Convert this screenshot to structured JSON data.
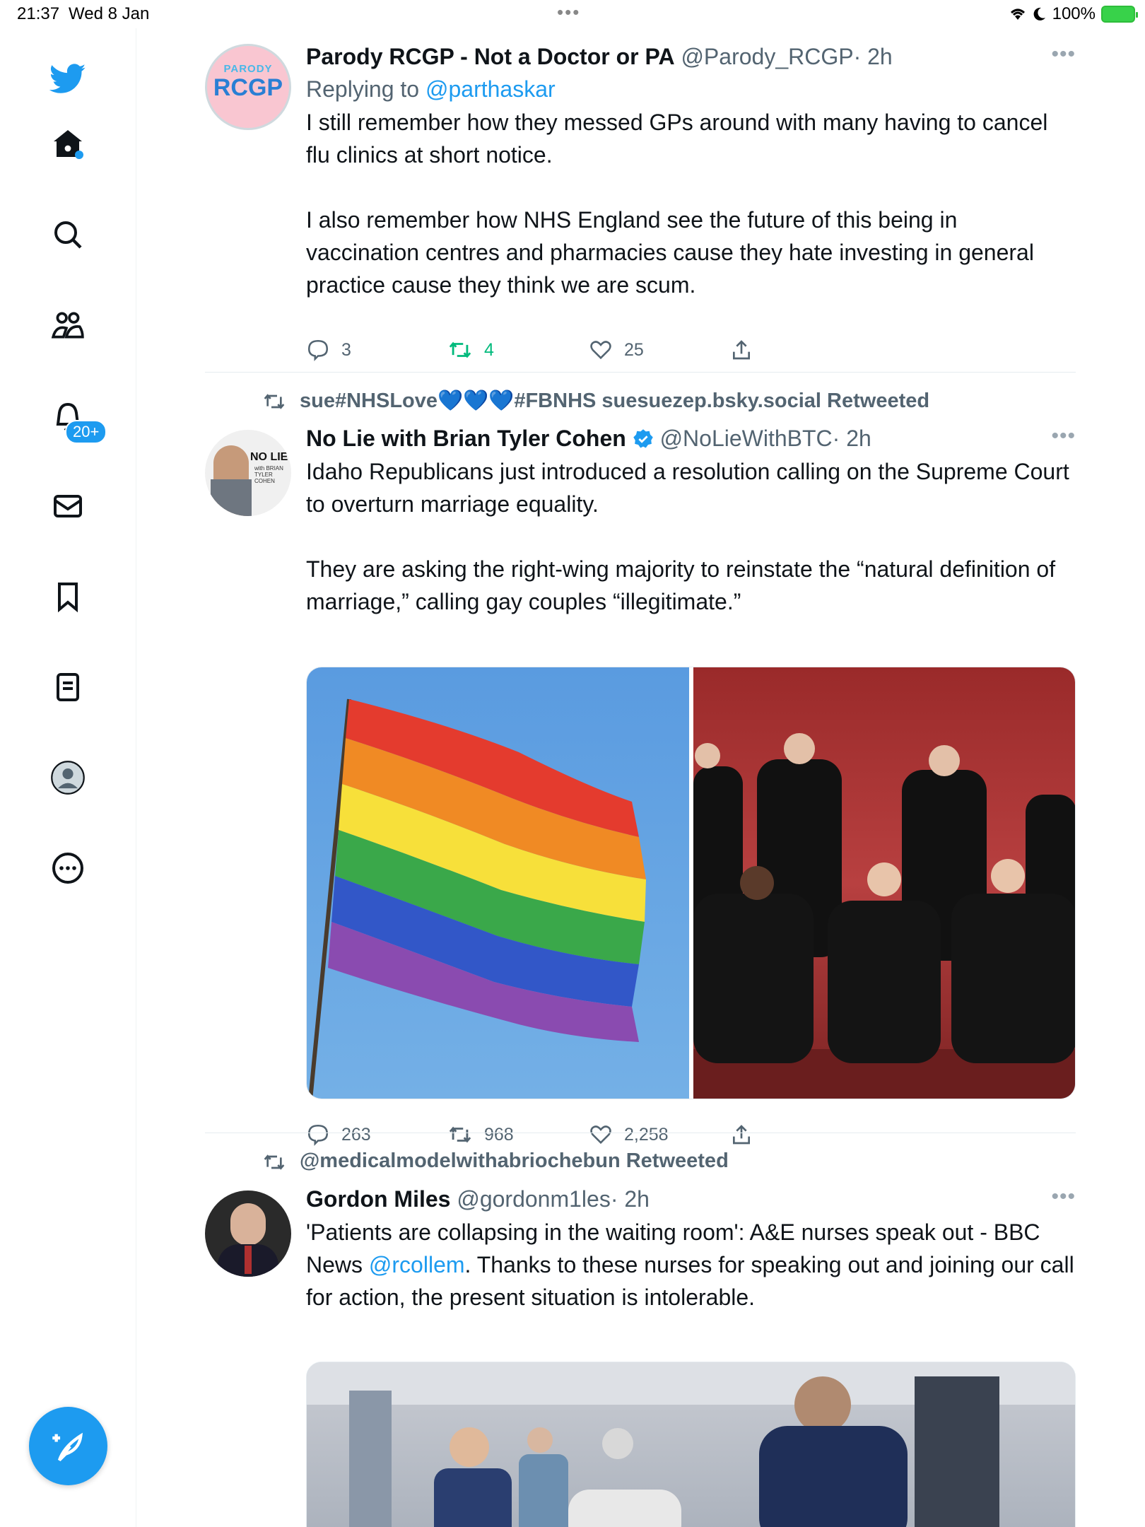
{
  "status_bar": {
    "time": "21:37",
    "date": "Wed 8 Jan",
    "battery": "100%"
  },
  "sidebar": {
    "notifications_badge": "20+",
    "items": [
      "home-icon",
      "search-icon",
      "communities-icon",
      "notifications-icon",
      "messages-icon",
      "bookmarks-icon",
      "lists-icon",
      "profile-icon",
      "more-icon"
    ]
  },
  "tweets": [
    {
      "avatar_text_top": "PARODY",
      "avatar_text_main": "RCGP",
      "name": "Parody RCGP - Not a Doctor or PA",
      "handle": "@Parody_RCGP",
      "time": "· 2h",
      "reply_prefix": "Replying to ",
      "reply_to": "@parthaskar",
      "paragraph1": "I still remember how they messed GPs around with many having to cancel flu clinics at short notice.",
      "paragraph2": "I also remember how NHS England see the future of this being in vaccination centres and pharmacies cause they hate investing in general practice cause they think we are scum.",
      "replies": "3",
      "retweets": "4",
      "likes": "25"
    },
    {
      "retweeted_by": "sue#NHSLove💙💙💙#FBNHS suesuezep.bsky.social Retweeted",
      "avatar_text": "NO LIE",
      "avatar_subtext": "with BRIAN TYLER COHEN",
      "name": "No Lie with Brian Tyler Cohen",
      "handle": "@NoLieWithBTC",
      "time": "· 2h",
      "paragraph1": "Idaho Republicans just introduced a resolution calling on the Supreme Court to overturn marriage equality.",
      "paragraph2": "They are asking the right-wing majority to reinstate the “natural definition of marriage,” calling gay couples “illegitimate.”",
      "replies": "263",
      "retweets": "968",
      "likes": "2,258"
    },
    {
      "retweeted_by": "@medicalmodelwithabriochebun Retweeted",
      "name": "Gordon Miles",
      "handle": "@gordonm1les",
      "time": "· 2h",
      "text_before_link": "'Patients are collapsing in the waiting room': A&E nurses speak out - BBC News ",
      "link": "@rcollem",
      "text_after_link": ". Thanks to these nurses for speaking out and joining our call for action, the present situation is intolerable."
    }
  ],
  "colors": {
    "accent": "#1d9bf0",
    "retweet_active": "#00ba7c",
    "secondary_text": "#536471"
  }
}
